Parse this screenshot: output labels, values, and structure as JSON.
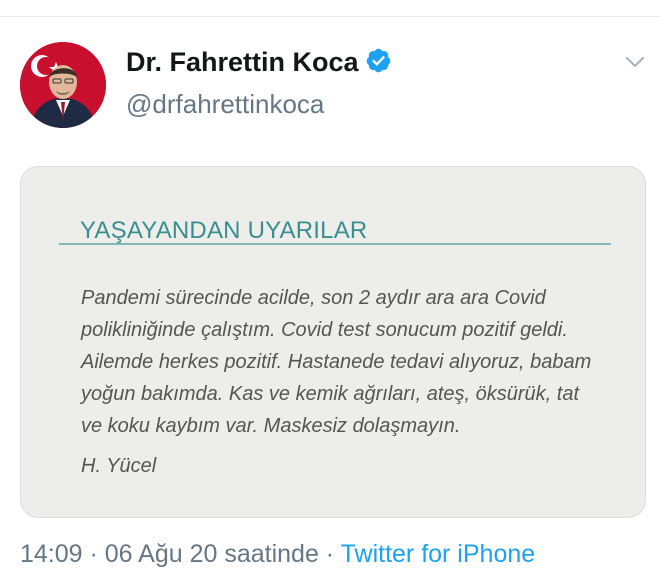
{
  "tweet": {
    "display_name": "Dr. Fahrettin Koca",
    "handle": "@drfahrettinkoca",
    "verified": true,
    "avatar_icon": "profile-photo",
    "more_icon": "chevron-down-icon"
  },
  "card": {
    "title": "YAŞAYANDAN UYARILAR",
    "lines": [
      "Pandemi sürecinde acilde, son 2 aydır ara ara Covid",
      "polikliniğinde çalıştım. Covid test sonucum pozitif geldi.",
      "Ailemde herkes pozitif. Hastanede tedavi alıyoruz, babam",
      "yoğun bakımda. Kas ve kemik ağrıları, ateş, öksürük, tat",
      "ve koku kaybım var. Maskesiz dolaşmayın."
    ],
    "signature": "H. Yücel"
  },
  "meta": {
    "time": "14:09",
    "separator1": " · ",
    "date": "06 Ağu 20 saatinde",
    "separator2": " · ",
    "source": "Twitter for iPhone"
  },
  "colors": {
    "accent": "#1da1f2",
    "card_title": "#3b8e90",
    "card_background": "#ededea"
  }
}
